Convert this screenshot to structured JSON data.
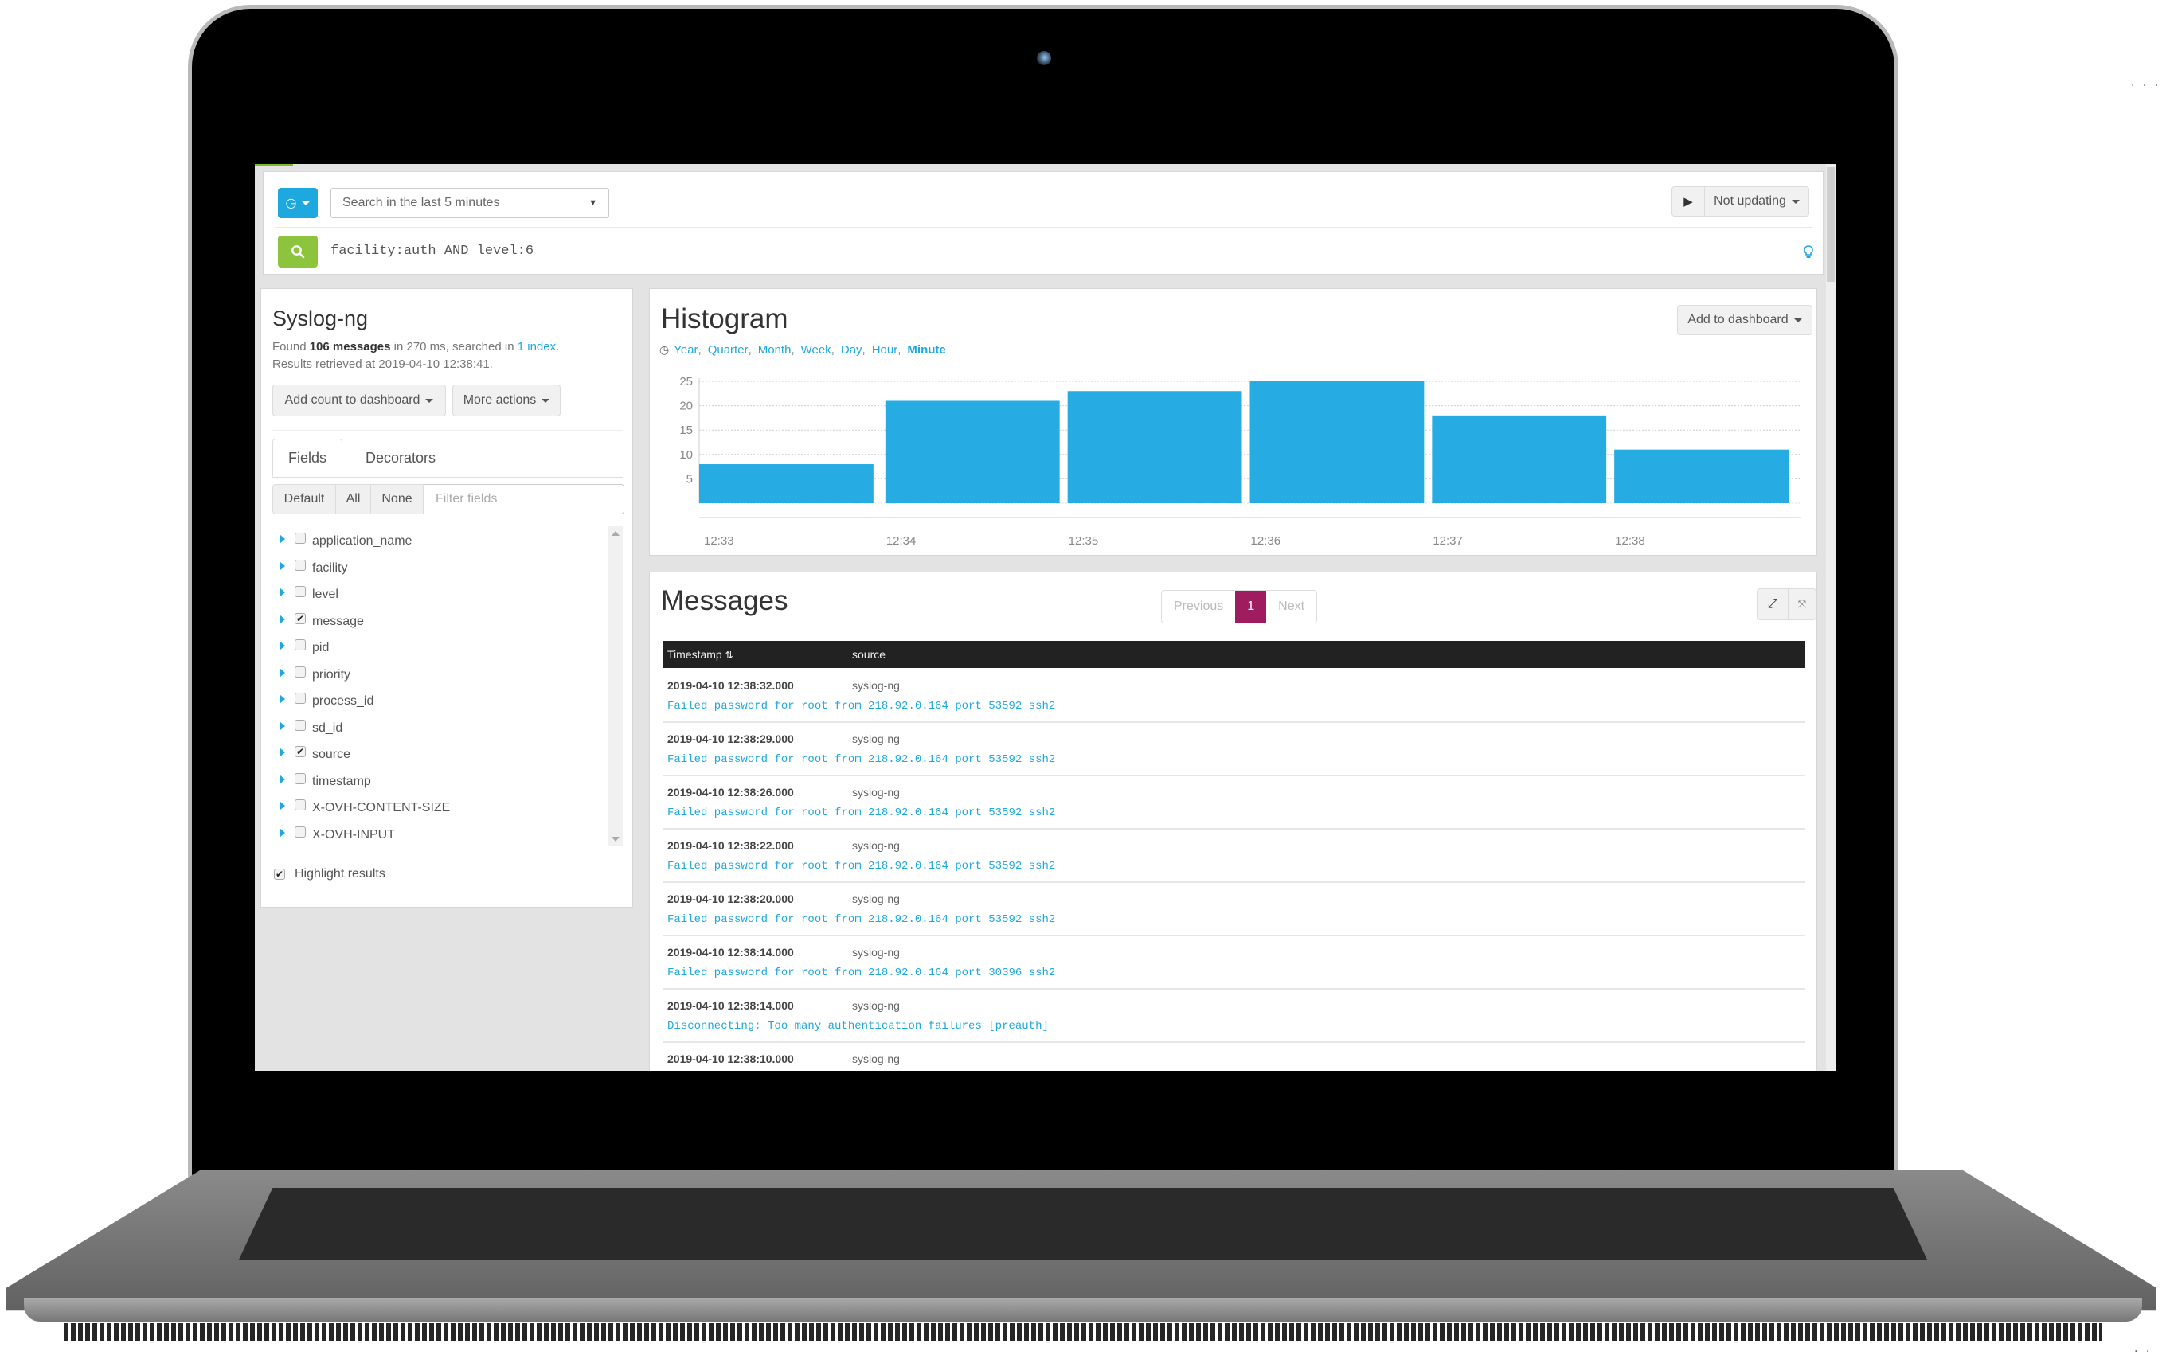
{
  "search": {
    "time_range_label": "Search in the last 5 minutes",
    "query": "facility:auth AND level:6",
    "refresh_label": "Not updating"
  },
  "sidebar": {
    "title": "Syslog-ng",
    "found_prefix": "Found",
    "found_count": "106 messages",
    "found_middle": "in 270 ms, searched in",
    "index_link": "1 index",
    "found_suffix": ".",
    "retrieved": "Results retrieved at 2019-04-10 12:38:41.",
    "add_count_button": "Add count to dashboard",
    "more_actions_button": "More actions",
    "tabs": [
      {
        "label": "Fields",
        "active": true
      },
      {
        "label": "Decorators",
        "active": false
      }
    ],
    "filter_buttons": [
      "Default",
      "All",
      "None"
    ],
    "filter_placeholder": "Filter fields",
    "fields": [
      {
        "name": "application_name",
        "checked": false
      },
      {
        "name": "facility",
        "checked": false
      },
      {
        "name": "level",
        "checked": false
      },
      {
        "name": "message",
        "checked": true
      },
      {
        "name": "pid",
        "checked": false
      },
      {
        "name": "priority",
        "checked": false
      },
      {
        "name": "process_id",
        "checked": false
      },
      {
        "name": "sd_id",
        "checked": false
      },
      {
        "name": "source",
        "checked": true
      },
      {
        "name": "timestamp",
        "checked": false
      },
      {
        "name": "X-OVH-CONTENT-SIZE",
        "checked": false
      },
      {
        "name": "X-OVH-INPUT",
        "checked": false
      }
    ],
    "highlight_label": "Highlight results",
    "highlight_checked": true
  },
  "histogram": {
    "title": "Histogram",
    "add_to_dashboard": "Add to dashboard",
    "resolutions": [
      "Year",
      "Quarter",
      "Month",
      "Week",
      "Day",
      "Hour",
      "Minute"
    ],
    "active_resolution": "Minute"
  },
  "chart_data": {
    "type": "bar",
    "title": "Histogram",
    "categories": [
      "12:33",
      "12:34",
      "12:35",
      "12:36",
      "12:37",
      "12:38"
    ],
    "values": [
      8,
      21,
      23,
      25,
      18,
      11
    ],
    "xlabel": "",
    "ylabel": "",
    "ylim": [
      0,
      25
    ],
    "yticks": [
      5,
      10,
      15,
      20,
      25
    ],
    "grid": true,
    "color": "#26abe2"
  },
  "messages": {
    "title": "Messages",
    "pagination": {
      "previous": "Previous",
      "current": "1",
      "next": "Next"
    },
    "columns": [
      "Timestamp",
      "source"
    ],
    "rows": [
      {
        "timestamp": "2019-04-10 12:38:32.000",
        "source": "syslog-ng",
        "message": "Failed password for root from 218.92.0.164 port 53592 ssh2"
      },
      {
        "timestamp": "2019-04-10 12:38:29.000",
        "source": "syslog-ng",
        "message": "Failed password for root from 218.92.0.164 port 53592 ssh2"
      },
      {
        "timestamp": "2019-04-10 12:38:26.000",
        "source": "syslog-ng",
        "message": "Failed password for root from 218.92.0.164 port 53592 ssh2"
      },
      {
        "timestamp": "2019-04-10 12:38:22.000",
        "source": "syslog-ng",
        "message": "Failed password for root from 218.92.0.164 port 53592 ssh2"
      },
      {
        "timestamp": "2019-04-10 12:38:20.000",
        "source": "syslog-ng",
        "message": "Failed password for root from 218.92.0.164 port 53592 ssh2"
      },
      {
        "timestamp": "2019-04-10 12:38:14.000",
        "source": "syslog-ng",
        "message": "Failed password for root from 218.92.0.164 port 30396 ssh2"
      },
      {
        "timestamp": "2019-04-10 12:38:14.000",
        "source": "syslog-ng",
        "message": "Disconnecting: Too many authentication failures [preauth]"
      },
      {
        "timestamp": "2019-04-10 12:38:10.000",
        "source": "syslog-ng",
        "message": ""
      }
    ]
  },
  "colors": {
    "accent": "#1ea8e0",
    "search_button": "#8cc43e",
    "active_page": "#a01c60",
    "table_header": "#222222"
  }
}
